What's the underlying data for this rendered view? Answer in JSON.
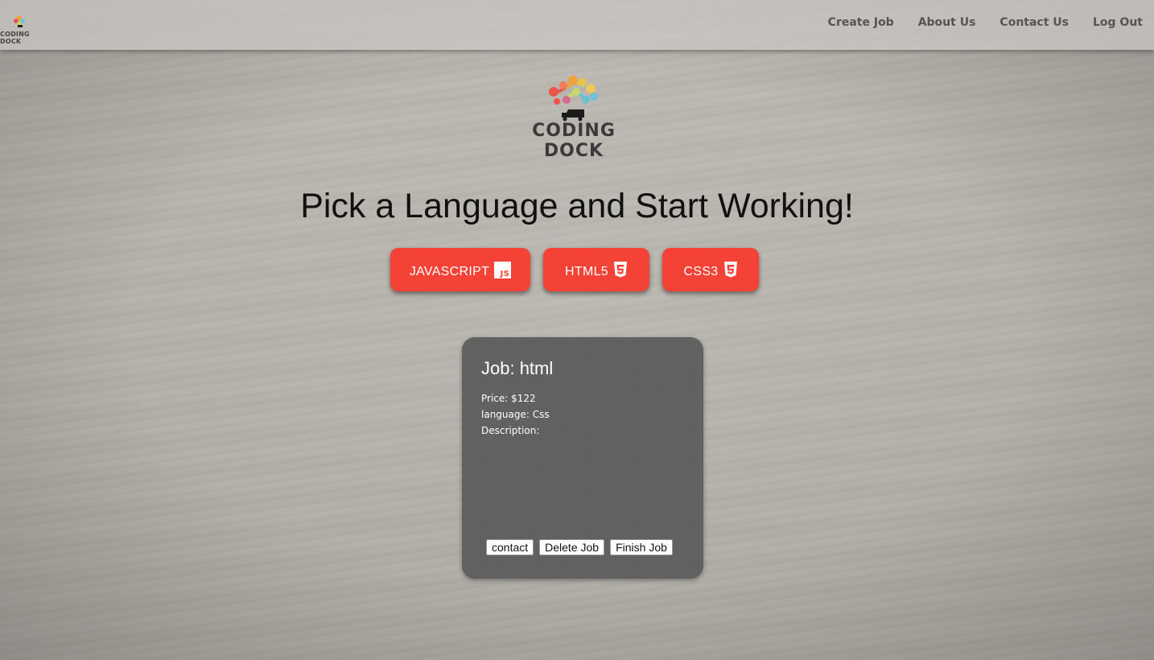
{
  "nav": {
    "logo_text": "CODING DOCK",
    "links": [
      "Create Job",
      "About Us",
      "Contact Us",
      "Log Out"
    ]
  },
  "hero": {
    "logo_text": "CODING DOCK",
    "headline": "Pick a Language and Start Working!"
  },
  "languages": [
    {
      "label": "JAVASCRIPT",
      "icon": "js-icon"
    },
    {
      "label": "HTML5",
      "icon": "html5-icon"
    },
    {
      "label": "CSS3",
      "icon": "css3-icon"
    }
  ],
  "job": {
    "title": "Job: html",
    "price": "Price: $122",
    "language": "language: Css",
    "description": "Description:",
    "buttons": {
      "contact": "contact",
      "delete": "Delete Job",
      "finish": "Finish Job"
    }
  },
  "colors": {
    "accent": "#f44336",
    "card": "#5f5f5f"
  }
}
